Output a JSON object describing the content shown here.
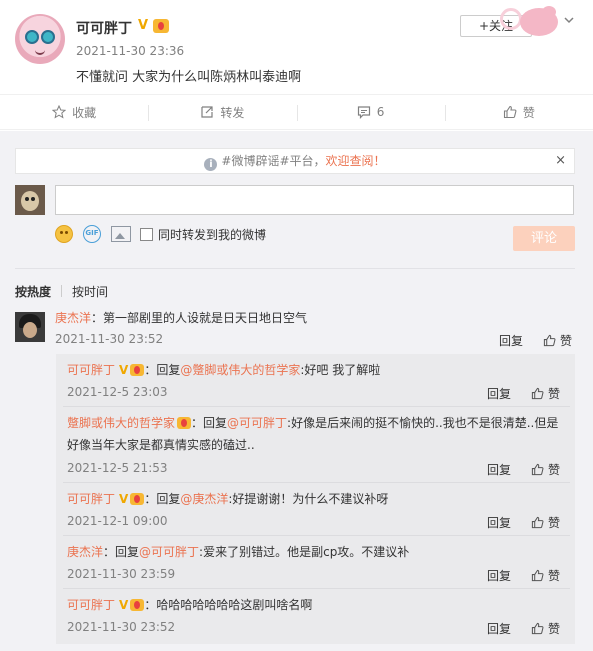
{
  "post": {
    "author": "可可胖丁",
    "verified_mark": "V",
    "time": "2021-11-30 23:36",
    "text": "不懂就问 大家为什么叫陈炳林叫泰迪啊",
    "follow_label": "+关注"
  },
  "actions": {
    "favorite": "收藏",
    "repost": "转发",
    "comment_count": "6",
    "like": "赞"
  },
  "notice": {
    "prefix": "#微博辟谣#平台，",
    "link": "欢迎查阅！",
    "close": "×"
  },
  "composer": {
    "input_value": "",
    "gif_label": "GIF",
    "checkbox_label": "同时转发到我的微博",
    "submit_label": "评论"
  },
  "sort": {
    "hot": "按热度",
    "time": "按时间"
  },
  "comment": {
    "user": "庚杰洋",
    "text": "：第一部剧里的人设就是日天日地日空气",
    "time": "2021-11-30 23:52",
    "reply_label": "回复",
    "like_label": "赞"
  },
  "replies": [
    {
      "user": "可可胖丁",
      "badges": true,
      "text": "：回复",
      "mention": "@蹩脚或伟大的哲学家",
      "rest": ":好吧 我了解啦",
      "time": "2021-12-5 23:03"
    },
    {
      "user": "蹩脚或伟大的哲学家",
      "badges": true,
      "text": "：回复",
      "mention": "@可可胖丁",
      "rest": ":好像是后来闹的挺不愉快的..我也不是很清楚..但是好像当年大家是都真情实感的磕过..",
      "time": "2021-12-5 21:53"
    },
    {
      "user": "可可胖丁",
      "badges": true,
      "text": "：回复",
      "mention": "@庚杰洋",
      "rest": ":好提谢谢！为什么不建议补呀",
      "time": "2021-12-1 09:00"
    },
    {
      "user": "庚杰洋",
      "badges": false,
      "text": "：回复",
      "mention": "@可可胖丁",
      "rest": ":爱来了别错过。他是副cp攻。不建议补",
      "time": "2021-11-30 23:59"
    },
    {
      "user": "可可胖丁",
      "badges": true,
      "text": "：",
      "mention": "",
      "rest": "哈哈哈哈哈哈哈这剧叫啥名啊",
      "time": "2021-11-30 23:52"
    }
  ],
  "reply_label": "回复",
  "like_label": "赞",
  "colors": {
    "accent": "#eb7350",
    "submit_disabled": "#fcd1bd",
    "verified": "#f0a800",
    "comment_bg": "#f2f2f5",
    "reply_bg": "#eaeaec"
  },
  "icons": [
    "star-icon",
    "repost-icon",
    "comment-icon",
    "thumbs-up-icon",
    "info-icon",
    "close-icon",
    "smiley-icon",
    "gif-icon",
    "image-icon",
    "chevron-down-icon"
  ]
}
